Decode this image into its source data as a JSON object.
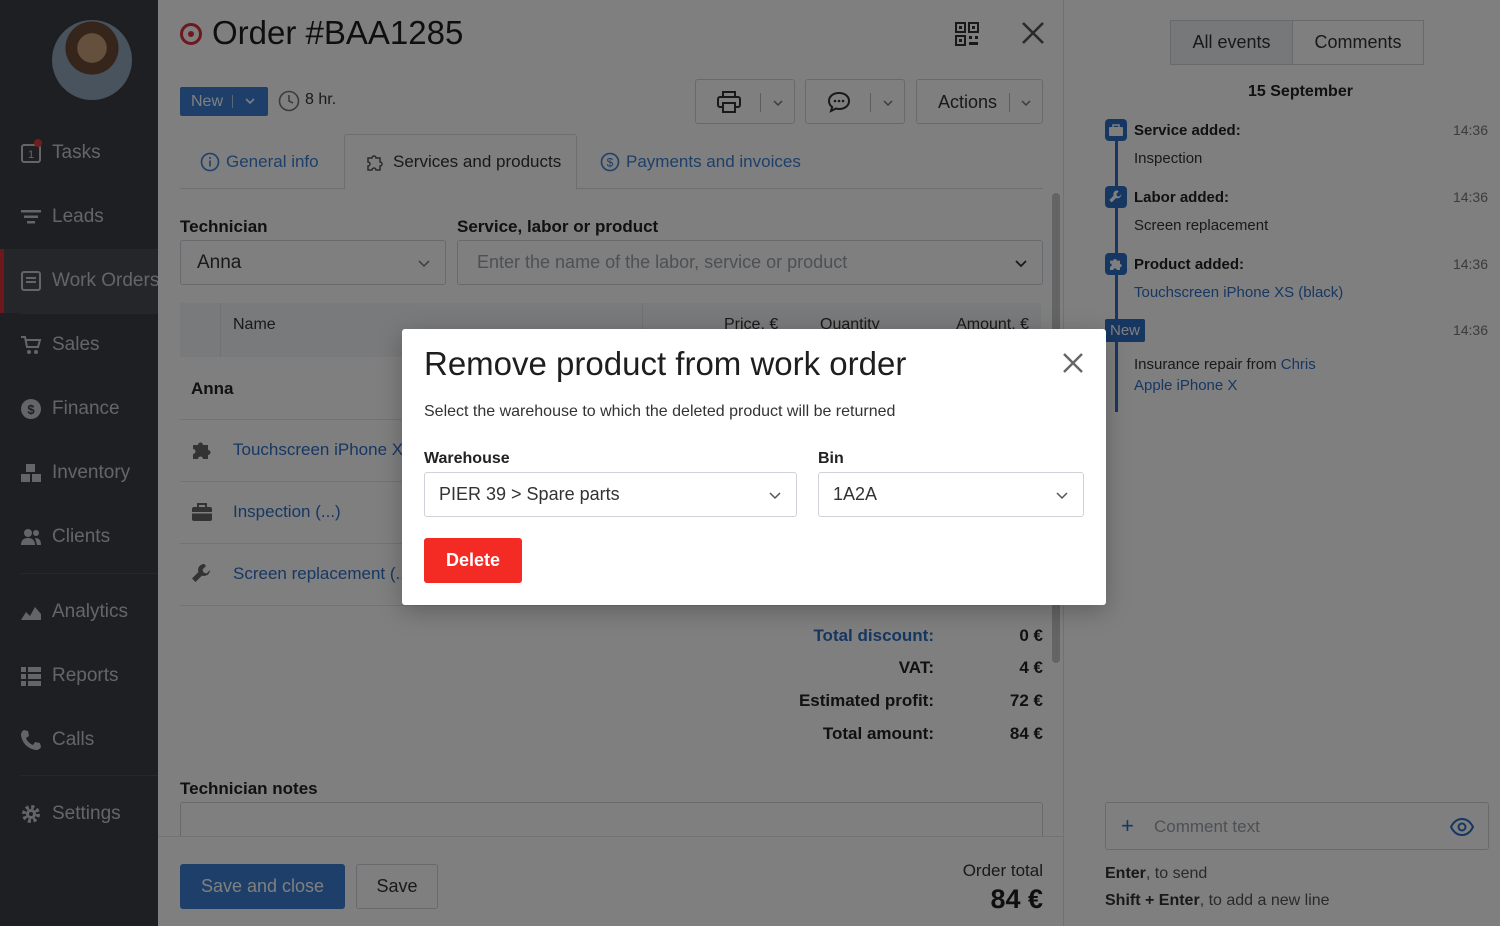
{
  "sidebar": {
    "items": [
      {
        "label": "Tasks",
        "icon": "tasks-icon"
      },
      {
        "label": "Leads",
        "icon": "leads-icon"
      },
      {
        "label": "Work Orders",
        "icon": "work-orders-icon"
      },
      {
        "label": "Sales",
        "icon": "cart-icon"
      },
      {
        "label": "Finance",
        "icon": "dollar-icon"
      },
      {
        "label": "Inventory",
        "icon": "boxes-icon"
      },
      {
        "label": "Clients",
        "icon": "clients-icon"
      },
      {
        "label": "Analytics",
        "icon": "chart-icon"
      },
      {
        "label": "Reports",
        "icon": "reports-icon"
      },
      {
        "label": "Calls",
        "icon": "phone-icon"
      },
      {
        "label": "Settings",
        "icon": "gear-icon"
      }
    ],
    "tasks_badge_count": "1",
    "active_item": "Work Orders"
  },
  "order": {
    "title": "Order #BAA1285",
    "status": "New",
    "duration": "8 hr.",
    "actions_label": "Actions"
  },
  "tabs": [
    {
      "label": "General info"
    },
    {
      "label": "Services and products"
    },
    {
      "label": "Payments and invoices"
    }
  ],
  "form": {
    "technician_label": "Technician",
    "technician_value": "Anna",
    "service_label": "Service, labor or product",
    "service_placeholder": "Enter the name of the labor, service or product"
  },
  "table": {
    "columns": {
      "name": "Name",
      "price": "Price, €",
      "quantity": "Quantity",
      "amount": "Amount, €"
    },
    "group": "Anna",
    "rows": [
      {
        "name": "Touchscreen iPhone XS",
        "icon": "puzzle-icon"
      },
      {
        "name": "Inspection (...)",
        "icon": "briefcase-icon"
      },
      {
        "name": "Screen replacement (...",
        "icon": "wrench-icon"
      }
    ]
  },
  "summary": {
    "total_discount_label": "Total discount:",
    "total_discount": "0 €",
    "vat_label": "VAT:",
    "vat": "4 €",
    "profit_label": "Estimated profit:",
    "profit": "72 €",
    "total_label": "Total amount:",
    "total": "84 €"
  },
  "notes": {
    "label": "Technician notes"
  },
  "footer": {
    "save_close": "Save and close",
    "save": "Save",
    "order_total_label": "Order total",
    "order_total_value": "84 €"
  },
  "right": {
    "tabs": [
      {
        "label": "All events"
      },
      {
        "label": "Comments"
      }
    ],
    "date": "15 September",
    "events": [
      {
        "title": "Service added:",
        "text": "Inspection",
        "time": "14:36",
        "icon": "briefcase-icon"
      },
      {
        "title": "Labor added:",
        "text": "Screen replacement",
        "time": "14:36",
        "icon": "wrench-icon"
      },
      {
        "title": "Product added:",
        "text": "Touchscreen iPhone XS (black)",
        "time": "14:36",
        "icon": "puzzle-icon"
      }
    ],
    "status_event": {
      "badge": "New",
      "time": "14:36",
      "text_prefix": "Insurance repair from ",
      "client": "Chris",
      "device": "Apple iPhone X"
    },
    "comment_placeholder": "Comment text",
    "hint1_key": "Enter",
    "hint1_text": ", to send",
    "hint2_key": "Shift + Enter",
    "hint2_text": ", to add a new line"
  },
  "modal": {
    "title": "Remove product from work order",
    "description": "Select the warehouse to which the deleted product will be returned",
    "warehouse_label": "Warehouse",
    "warehouse_value": "PIER 39 > Spare parts",
    "bin_label": "Bin",
    "bin_value": "1A2A",
    "delete_label": "Delete"
  },
  "colors": {
    "accent": "#3a7fd4",
    "danger": "#f42a25",
    "sidebar": "#3a3e47",
    "brand_red": "#d8303d"
  }
}
